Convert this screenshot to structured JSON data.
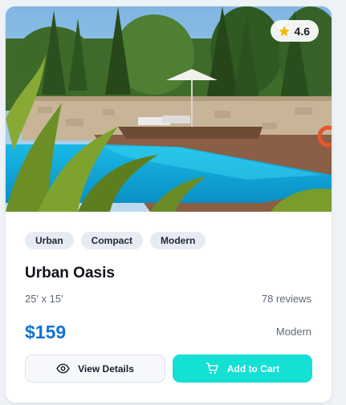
{
  "listing": {
    "image_alt": "Urban Oasis pool photo",
    "rating": "4.6",
    "tags": [
      "Urban",
      "Compact",
      "Modern"
    ],
    "title": "Urban Oasis",
    "dimensions": "25' x 15'",
    "reviews": "78 reviews",
    "price": "$159",
    "style": "Modern"
  },
  "actions": {
    "details_label": "View Details",
    "cart_label": "Add to Cart"
  },
  "icons": {
    "rating": "star-icon",
    "details": "eye-icon",
    "cart": "cart-icon"
  },
  "colors": {
    "accent": "#14e0d4",
    "price": "#1273d4",
    "star": "#f5b800"
  }
}
